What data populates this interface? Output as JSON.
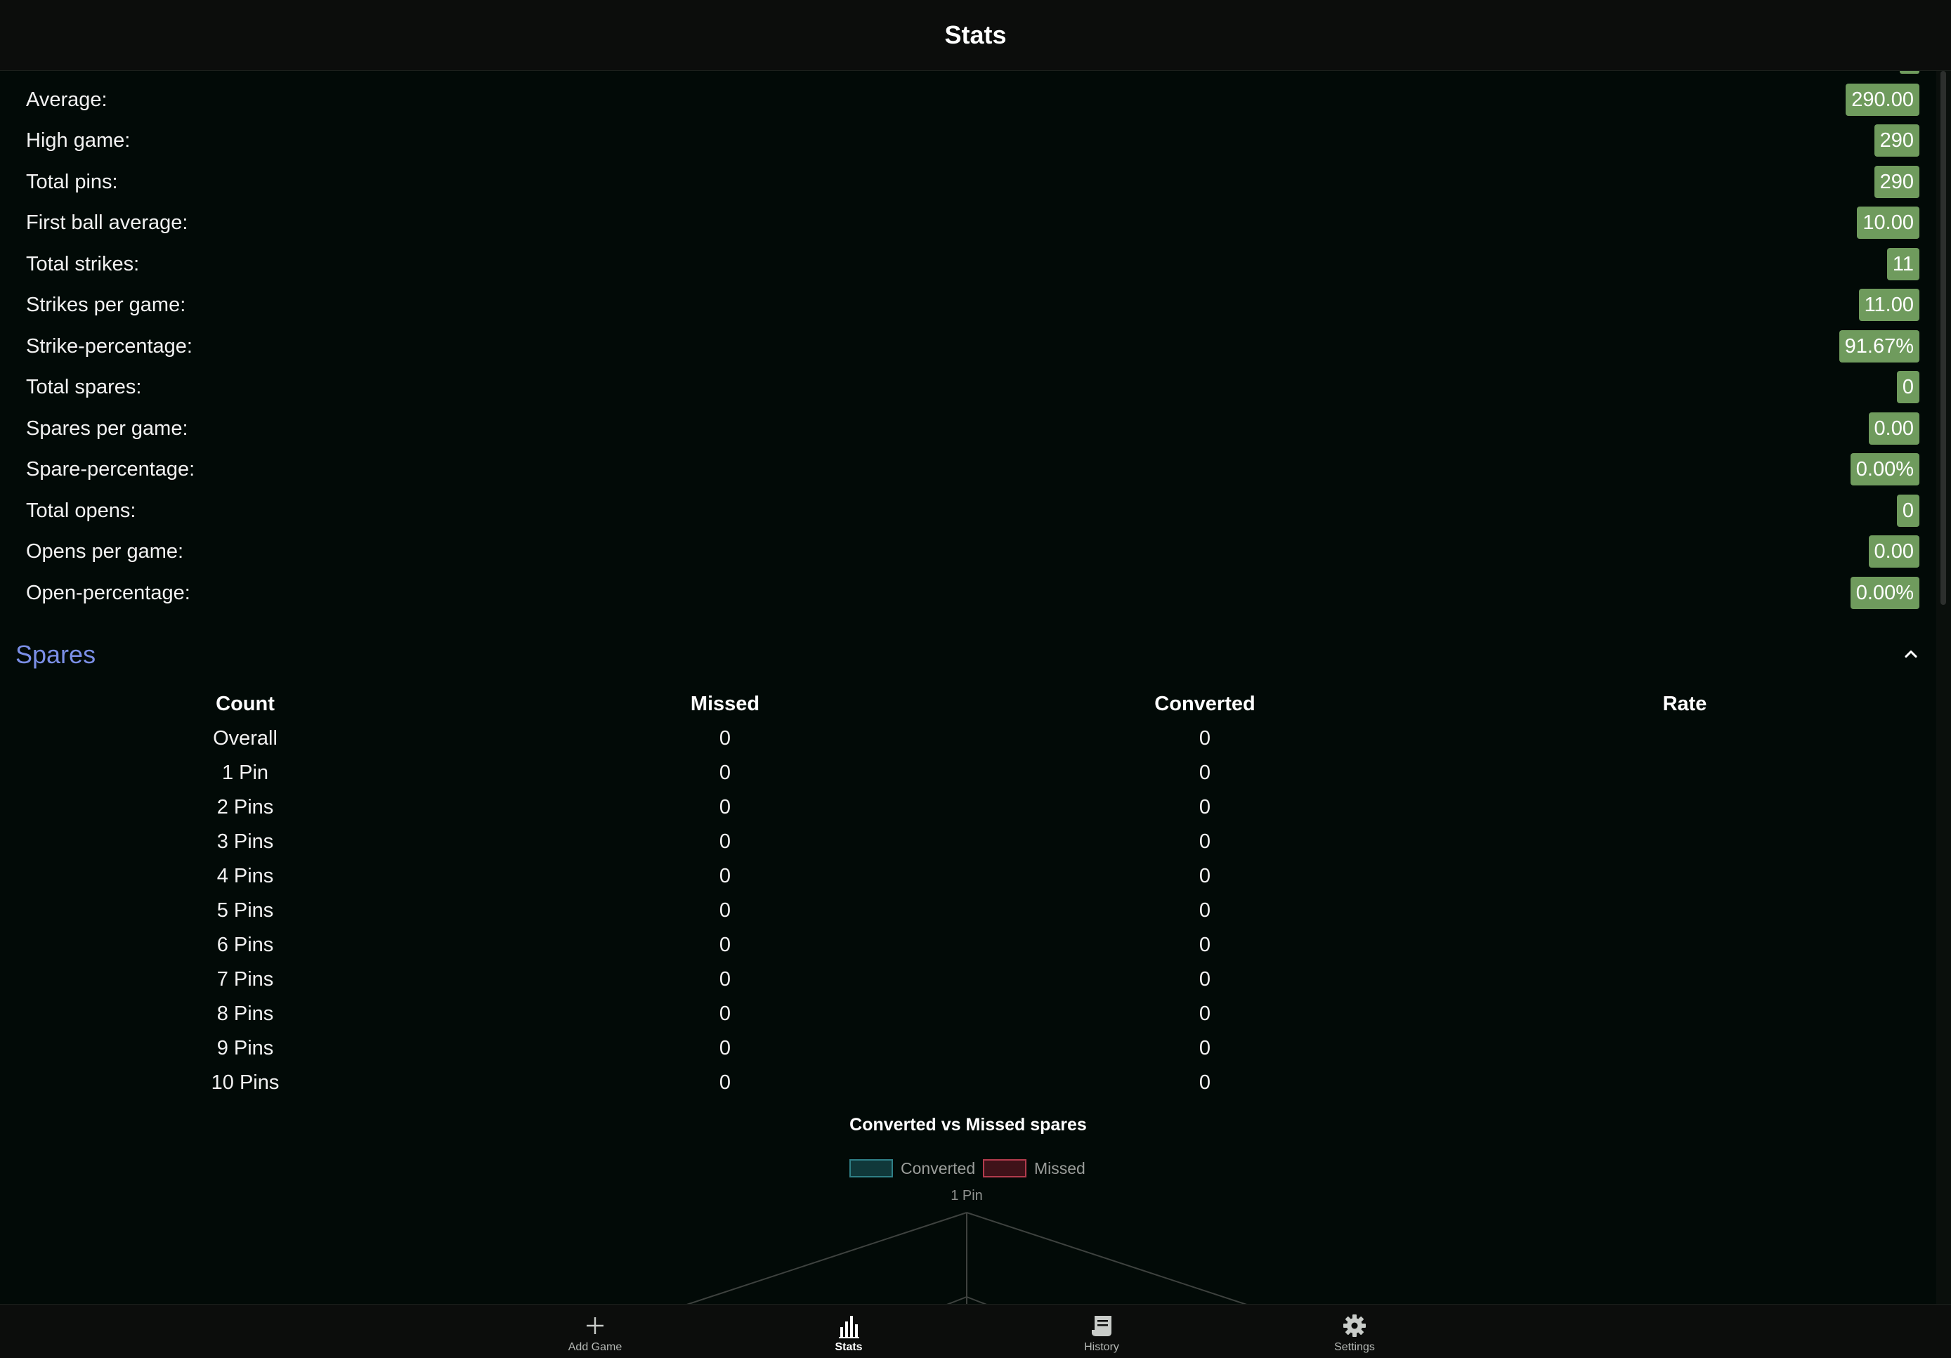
{
  "header": {
    "title": "Stats"
  },
  "stats": [
    {
      "label": "Average:",
      "value": "290.00"
    },
    {
      "label": "High game:",
      "value": "290"
    },
    {
      "label": "Total pins:",
      "value": "290"
    },
    {
      "label": "First ball average:",
      "value": "10.00"
    },
    {
      "label": "Total strikes:",
      "value": "11"
    },
    {
      "label": "Strikes per game:",
      "value": "11.00"
    },
    {
      "label": "Strike-percentage:",
      "value": "91.67%"
    },
    {
      "label": "Total spares:",
      "value": "0"
    },
    {
      "label": "Spares per game:",
      "value": "0.00"
    },
    {
      "label": "Spare-percentage:",
      "value": "0.00%"
    },
    {
      "label": "Total opens:",
      "value": "0"
    },
    {
      "label": "Opens per game:",
      "value": "0.00"
    },
    {
      "label": "Open-percentage:",
      "value": "0.00%"
    }
  ],
  "spares": {
    "title": "Spares",
    "columns": [
      "Count",
      "Missed",
      "Converted",
      "Rate"
    ],
    "rows": [
      {
        "count": "Overall",
        "missed": "0",
        "converted": "0",
        "rate": ""
      },
      {
        "count": "1 Pin",
        "missed": "0",
        "converted": "0",
        "rate": ""
      },
      {
        "count": "2 Pins",
        "missed": "0",
        "converted": "0",
        "rate": ""
      },
      {
        "count": "3 Pins",
        "missed": "0",
        "converted": "0",
        "rate": ""
      },
      {
        "count": "4 Pins",
        "missed": "0",
        "converted": "0",
        "rate": ""
      },
      {
        "count": "5 Pins",
        "missed": "0",
        "converted": "0",
        "rate": ""
      },
      {
        "count": "6 Pins",
        "missed": "0",
        "converted": "0",
        "rate": ""
      },
      {
        "count": "7 Pins",
        "missed": "0",
        "converted": "0",
        "rate": ""
      },
      {
        "count": "8 Pins",
        "missed": "0",
        "converted": "0",
        "rate": ""
      },
      {
        "count": "9 Pins",
        "missed": "0",
        "converted": "0",
        "rate": ""
      },
      {
        "count": "10 Pins",
        "missed": "0",
        "converted": "0",
        "rate": ""
      }
    ]
  },
  "chart_data": {
    "type": "radar",
    "title": "Converted vs Missed spares",
    "legend_position": "top",
    "categories": [
      "1 Pin"
    ],
    "series": [
      {
        "name": "Converted",
        "color": "#2f7f86",
        "values": [
          0
        ]
      },
      {
        "name": "Missed",
        "color": "#b23b4d",
        "values": [
          0
        ]
      }
    ],
    "grid": true
  },
  "colors": {
    "accent": "#7b8fe6",
    "badge": "#6f9b5d",
    "background": "#020a07"
  },
  "nav": [
    {
      "label": "Add Game",
      "icon": "plus-icon",
      "active": false
    },
    {
      "label": "Stats",
      "icon": "bar-chart-icon",
      "active": true
    },
    {
      "label": "History",
      "icon": "receipt-icon",
      "active": false
    },
    {
      "label": "Settings",
      "icon": "gear-icon",
      "active": false
    }
  ]
}
